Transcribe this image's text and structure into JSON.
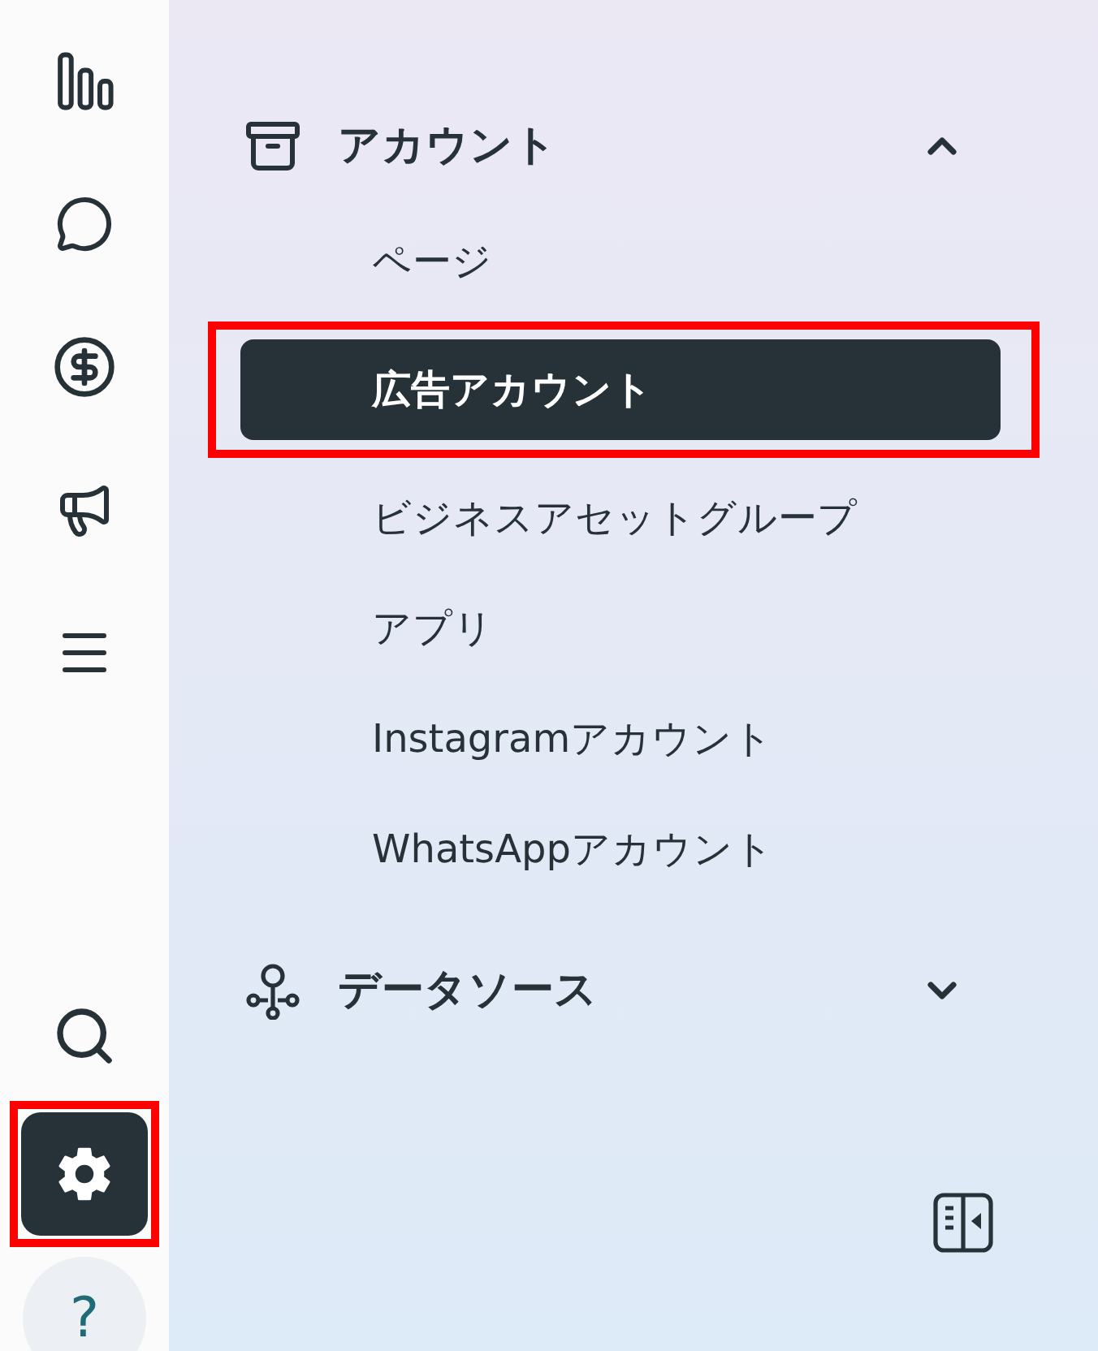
{
  "rail": {
    "items": [
      {
        "kind": "insights",
        "selected": false,
        "highlighted": false
      },
      {
        "kind": "messages",
        "selected": false,
        "highlighted": false
      },
      {
        "kind": "billing",
        "selected": false,
        "highlighted": false
      },
      {
        "kind": "ads",
        "selected": false,
        "highlighted": false
      },
      {
        "kind": "menu",
        "selected": false,
        "highlighted": false
      }
    ],
    "bottom_items": [
      {
        "kind": "search",
        "selected": false,
        "highlighted": false
      },
      {
        "kind": "settings",
        "selected": true,
        "highlighted": true
      }
    ],
    "help": {
      "label": "?"
    }
  },
  "sections": [
    {
      "kind": "accounts",
      "title": "アカウント",
      "expanded": true,
      "items": [
        {
          "label": "ページ",
          "selected": false,
          "highlighted": false
        },
        {
          "label": "広告アカウント",
          "selected": true,
          "highlighted": true
        },
        {
          "label": "ビジネスアセットグループ",
          "selected": false,
          "highlighted": false
        },
        {
          "label": "アプリ",
          "selected": false,
          "highlighted": false
        },
        {
          "label": "Instagramアカウント",
          "selected": false,
          "highlighted": false
        },
        {
          "label": "WhatsAppアカウント",
          "selected": false,
          "highlighted": false
        }
      ]
    },
    {
      "kind": "data_sources",
      "title": "データソース",
      "expanded": false
    }
  ]
}
